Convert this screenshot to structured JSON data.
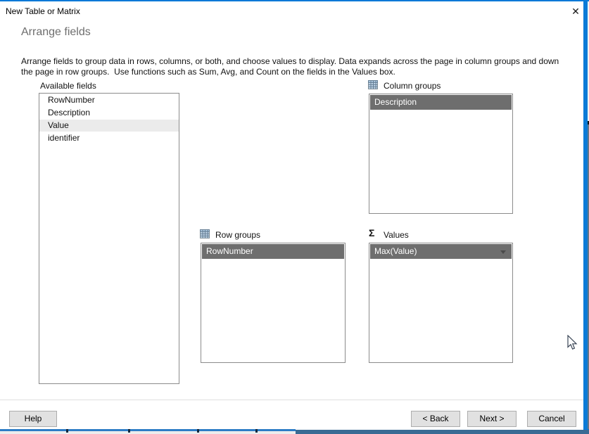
{
  "dialog": {
    "title": "New Table or Matrix",
    "heading": "Arrange fields",
    "description": "Arrange fields to group data in rows, columns, or both, and choose values to display. Data expands across the page in column groups and down the page in row groups.  Use functions such as Sum, Avg, and Count on the fields in the Values box."
  },
  "icons": {
    "close": "✕",
    "sigma": "Σ"
  },
  "available_fields": {
    "label": "Available fields",
    "items": [
      {
        "label": "RowNumber"
      },
      {
        "label": "Description"
      },
      {
        "label": "Value",
        "selected": true
      },
      {
        "label": "identifier"
      }
    ]
  },
  "column_groups": {
    "label": "Column groups",
    "items": [
      {
        "label": "Description",
        "selected": true
      }
    ]
  },
  "row_groups": {
    "label": "Row groups",
    "items": [
      {
        "label": "RowNumber",
        "selected": true
      }
    ]
  },
  "values": {
    "label": "Values",
    "items": [
      {
        "label": "Max(Value)",
        "selected": true,
        "has_dropdown": true
      }
    ]
  },
  "buttons": {
    "help": "Help",
    "back": "< Back",
    "next": "Next >",
    "cancel": "Cancel"
  },
  "colors": {
    "accent_blue": "#0078d7",
    "selection_dark": "#6e6e6e",
    "selection_light": "#ebebeb",
    "button_face": "#e1e1e1"
  }
}
